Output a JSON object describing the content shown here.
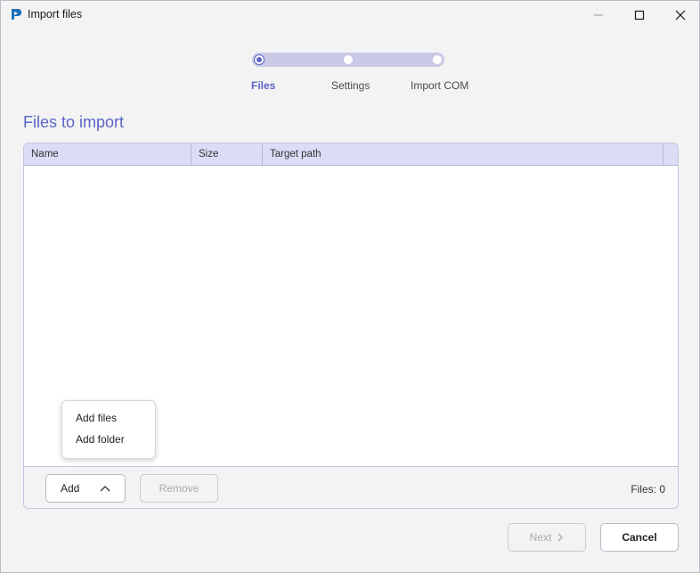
{
  "window": {
    "title": "Import files",
    "icons": {
      "app": "app-logo-icon",
      "minimize": "minimize-icon",
      "maximize": "maximize-icon",
      "close": "close-icon"
    }
  },
  "stepper": {
    "steps": [
      {
        "label": "Files",
        "active": true
      },
      {
        "label": "Settings",
        "active": false
      },
      {
        "label": "Import COM",
        "active": false
      }
    ]
  },
  "section_title": "Files to import",
  "table": {
    "columns": [
      "Name",
      "Size",
      "Target path"
    ],
    "rows": []
  },
  "footer": {
    "add_label": "Add",
    "remove_label": "Remove",
    "files_count": "Files: 0"
  },
  "add_menu": {
    "items": [
      "Add files",
      "Add folder"
    ]
  },
  "actions": {
    "next_label": "Next",
    "cancel_label": "Cancel"
  },
  "colors": {
    "accent": "#5b64c6",
    "header_bg": "#dcdcf6",
    "track": "#c8c9e6"
  }
}
